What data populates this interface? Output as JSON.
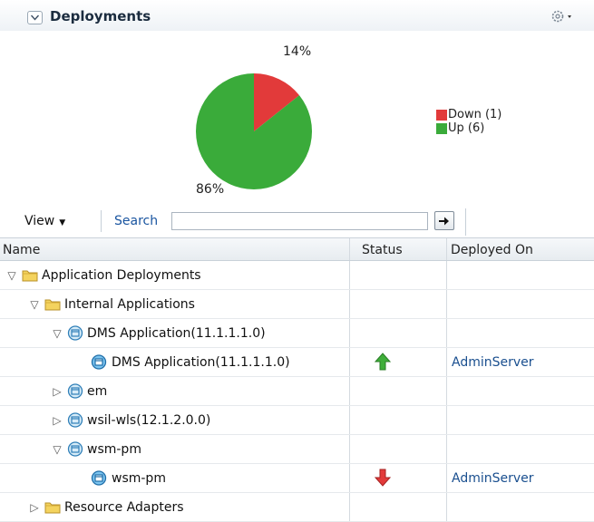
{
  "panel": {
    "title": "Deployments",
    "icons": [
      "collapse-toggle-icon",
      "gear-menu-icon"
    ]
  },
  "chart_data": {
    "type": "pie",
    "categories": [
      "Down (1)",
      "Up (6)"
    ],
    "values": [
      1,
      6
    ],
    "percent_labels": [
      "14%",
      "86%"
    ],
    "colors": [
      "#e23a3a",
      "#3aab3a"
    ],
    "legend_position": "right",
    "title": ""
  },
  "toolbar": {
    "view_label": "View",
    "search_label": "Search",
    "search_value": "",
    "go_icon": "arrow-right-icon"
  },
  "table": {
    "columns": [
      "Name",
      "Status",
      "Deployed On"
    ],
    "rows": [
      {
        "name": "Application Deployments",
        "level": 0,
        "disclosure": "expanded",
        "icon": "folder-icon",
        "status": "",
        "deployed_on": ""
      },
      {
        "name": "Internal Applications",
        "level": 1,
        "disclosure": "expanded",
        "icon": "folder-icon",
        "status": "",
        "deployed_on": ""
      },
      {
        "name": "DMS Application(11.1.1.1.0)",
        "level": 2,
        "disclosure": "expanded",
        "icon": "application-icon",
        "status": "",
        "deployed_on": ""
      },
      {
        "name": "DMS Application(11.1.1.1.0)",
        "level": 3,
        "disclosure": "none",
        "icon": "application-deployed-icon",
        "status": "up",
        "deployed_on": "AdminServer"
      },
      {
        "name": "em",
        "level": 2,
        "disclosure": "collapsed",
        "icon": "application-icon",
        "status": "",
        "deployed_on": ""
      },
      {
        "name": "wsil-wls(12.1.2.0.0)",
        "level": 2,
        "disclosure": "collapsed",
        "icon": "application-icon",
        "status": "",
        "deployed_on": ""
      },
      {
        "name": "wsm-pm",
        "level": 2,
        "disclosure": "expanded",
        "icon": "application-icon",
        "status": "",
        "deployed_on": ""
      },
      {
        "name": "wsm-pm",
        "level": 3,
        "disclosure": "none",
        "icon": "application-deployed-icon",
        "status": "down",
        "deployed_on": "AdminServer"
      },
      {
        "name": "Resource Adapters",
        "level": 1,
        "disclosure": "collapsed",
        "icon": "folder-icon",
        "status": "",
        "deployed_on": ""
      }
    ]
  }
}
